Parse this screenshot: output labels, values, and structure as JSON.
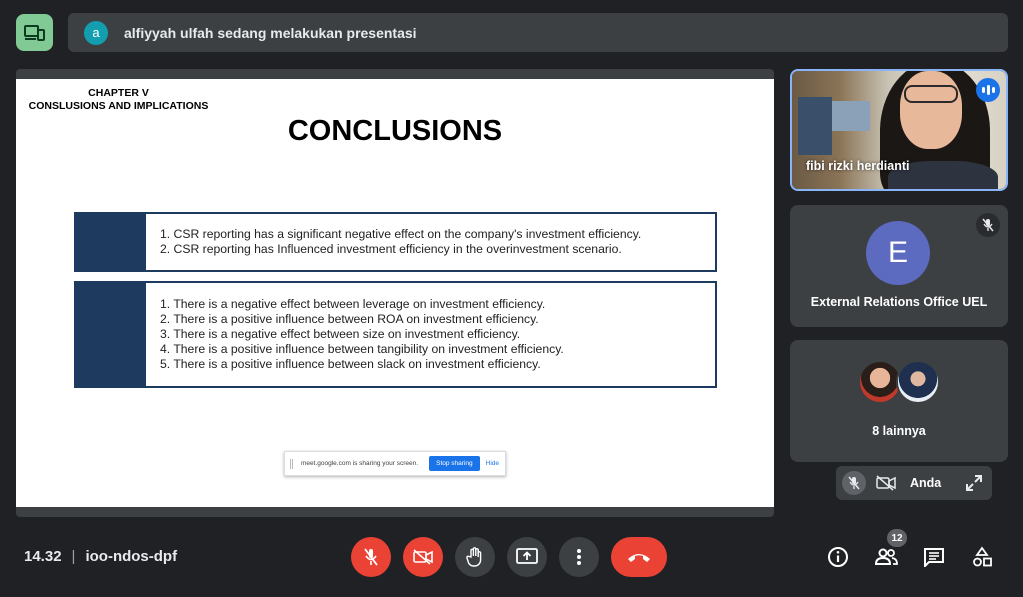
{
  "banner": {
    "avatar_letter": "a",
    "presenting_text": "alfiyyah ulfah sedang melakukan presentasi"
  },
  "slide": {
    "chapter": "CHAPTER V",
    "chapter_sub": "CONSLUSIONS AND IMPLICATIONS",
    "title": "CONCLUSIONS",
    "box1_items": [
      "1. CSR reporting has a significant negative effect on the company's investment efficiency.",
      "2. CSR reporting has Influenced investment efficiency in the overinvestment scenario."
    ],
    "box2_items": [
      "1. There is a negative effect between leverage on investment efficiency.",
      "2. There is a positive influence between ROA on investment efficiency.",
      "3. There is a negative effect between size on investment efficiency.",
      "4. There is a positive influence between tangibility on investment efficiency.",
      "5. There is a positive influence between slack on investment efficiency."
    ],
    "share_bar": {
      "text": "meet.google.com is sharing your screen.",
      "stop_label": "Stop sharing",
      "hide_label": "Hide"
    }
  },
  "participants": {
    "tile1_name": "fibi rizki herdianti",
    "tile2_letter": "E",
    "tile2_name": "External Relations Office UEL",
    "tile3_more": "8 lainnya",
    "self_name": "Anda"
  },
  "meeting": {
    "time": "14.32",
    "code": "ioo-ndos-dpf",
    "people_count": "12"
  },
  "colors": {
    "accent": "#8ab4f8",
    "danger": "#ea4335",
    "slide_navy": "#1f3a5f"
  }
}
